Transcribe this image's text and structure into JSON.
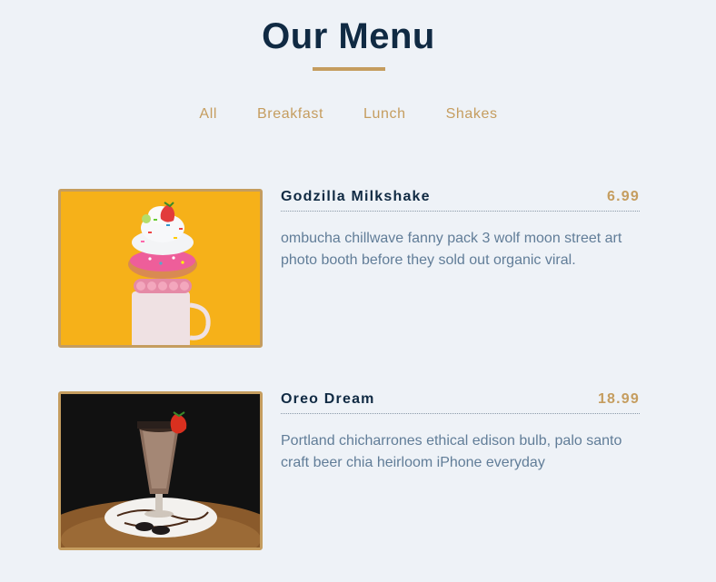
{
  "page": {
    "title": "Our Menu"
  },
  "filters": [
    {
      "label": "All"
    },
    {
      "label": "Breakfast"
    },
    {
      "label": "Lunch"
    },
    {
      "label": "Shakes"
    }
  ],
  "items": [
    {
      "name": "Godzilla Milkshake",
      "price": "6.99",
      "description": "ombucha chillwave fanny pack 3 wolf moon street art photo booth before they sold out organic viral.",
      "image": "milkshake-donut-photo"
    },
    {
      "name": "Oreo Dream",
      "price": "18.99",
      "description": "Portland chicharrones ethical edison bulb, palo santo craft beer chia heirloom iPhone everyday",
      "image": "oreo-shake-photo"
    }
  ],
  "colors": {
    "background": "#eef2f7",
    "accent": "#c59d5f",
    "heading": "#102a43",
    "body_text": "#617d98"
  }
}
